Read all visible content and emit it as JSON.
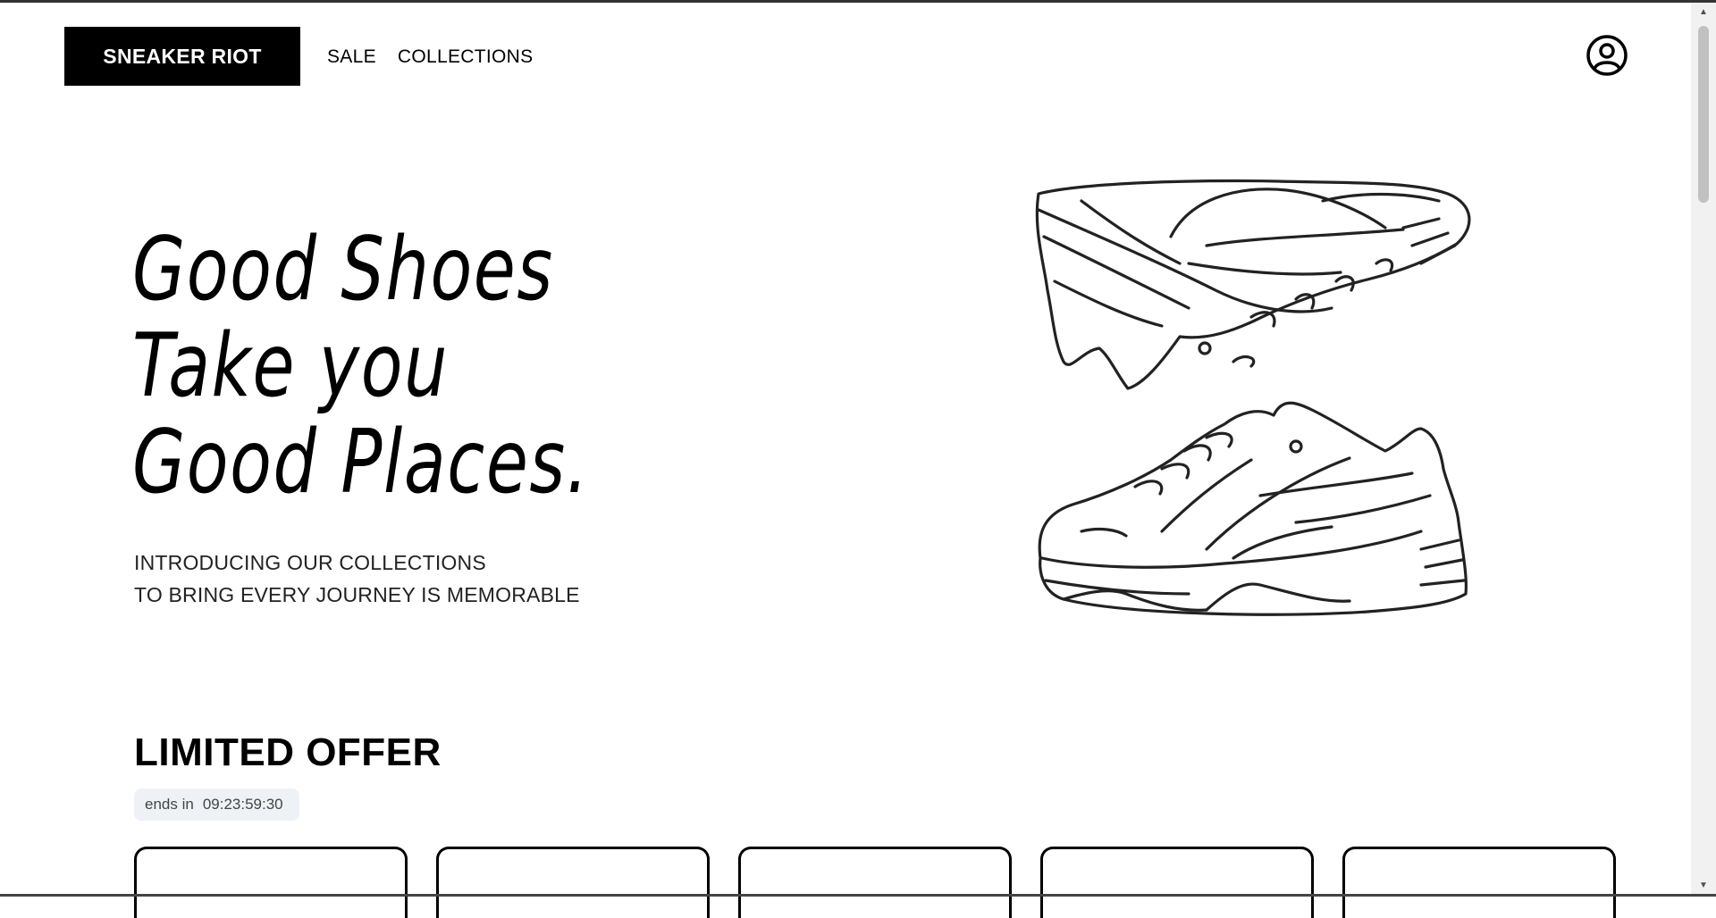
{
  "header": {
    "logo": "SNEAKER RIOT",
    "nav": [
      {
        "label": "SALE"
      },
      {
        "label": "COLLECTIONS"
      }
    ],
    "account_icon": "user-circle-icon"
  },
  "hero": {
    "title_lines": [
      "Good Shoes",
      "Take you",
      "Good Places."
    ],
    "subtitle_lines": [
      "INTRODUCING OUR COLLECTIONS",
      "TO BRING EVERY JOURNEY IS MEMORABLE"
    ],
    "illustration": "sneaker-sketch"
  },
  "offer": {
    "title": "LIMITED OFFER",
    "ends_label": "ends in",
    "countdown": "09:23:59:30",
    "cards": [
      {},
      {},
      {},
      {},
      {}
    ]
  },
  "colors": {
    "accent": "#000000",
    "countdown_bg": "#eef2f6"
  }
}
